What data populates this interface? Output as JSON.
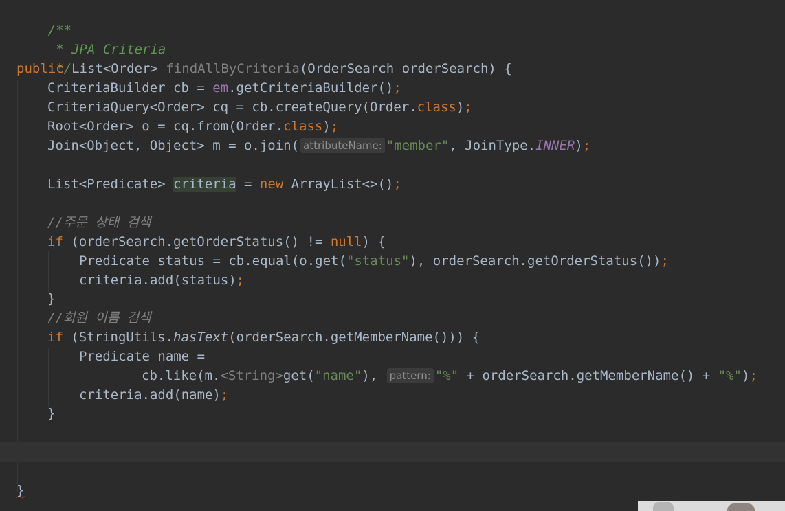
{
  "code": {
    "line_01": "/**",
    "line_02": " * JPA Criteria",
    "line_03": " */",
    "kw_public": "public",
    "list_order_type": "List<Order>",
    "method_name": "findAllByCriteria",
    "method_params": "(OrderSearch orderSearch) {",
    "cb_decl": "CriteriaBuilder cb = ",
    "em_field": "em",
    "cb_call": ".getCriteriaBuilder()",
    "cq_decl": "CriteriaQuery<Order> cq = cb.createQuery(Order.",
    "kw_class": "class",
    "root_decl": "Root<Order> o = cq.from(Order.",
    "join_decl": "Join<Object, Object> m = o.join(",
    "hint_attribute_name": "attributeName:",
    "str_member": "\"member\"",
    "join_type": ", JoinType.",
    "inner_const": "INNER",
    "list_pred_decl": "List<Predicate> ",
    "criteria_var": "criteria",
    "assign": " = ",
    "kw_new": "new",
    "array_list": " ArrayList<>()",
    "comment_order_status": "//주문 상태 검색",
    "kw_if": "if",
    "if_status_cond_start": " (orderSearch.getOrderStatus() != ",
    "kw_null": "null",
    "if_status_cond_end": ") {",
    "pred_status_start": "Predicate status = cb.equal(o.get(",
    "str_status": "\"status\"",
    "pred_status_end": "), orderSearch.getOrderStatus())",
    "criteria_add_status": "criteria.add(status)",
    "close_brace": "}",
    "comment_member_name": "//회원 이름 검색",
    "if_name_start": " (StringUtils.",
    "has_text": "hasText",
    "if_name_end": "(orderSearch.getMemberName())) {",
    "pred_name_decl": "Predicate name =",
    "like_start": "cb.like(m.",
    "generic_string": "<String>",
    "get_call": "get(",
    "str_name": "\"name\"",
    "like_sep": "),",
    "hint_pattern": "pattern:",
    "str_percent": "\"%\"",
    "concat_member": " + orderSearch.getMemberName() + ",
    "like_end": ")",
    "criteria_add_name": "criteria.add(name)",
    "semicolon": ";"
  },
  "colors": {
    "background": "#2b2b2b",
    "default_text": "#a9b7c6",
    "keyword": "#cc7832",
    "doc_comment": "#629755",
    "line_comment": "#808080",
    "string": "#6a8759",
    "field": "#9876aa",
    "usage_highlight": "#344134"
  }
}
